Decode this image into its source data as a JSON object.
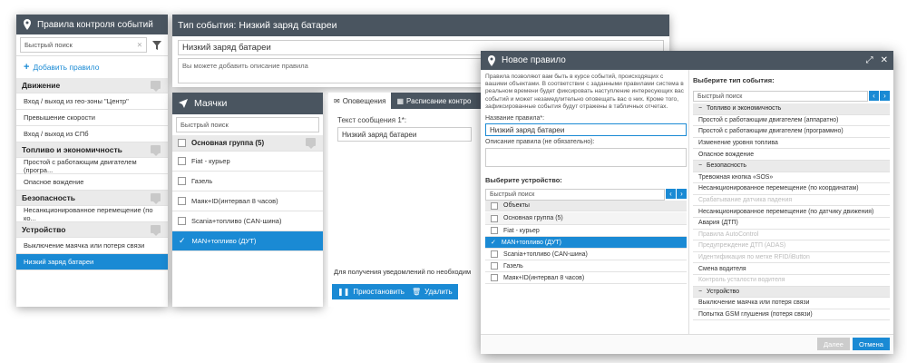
{
  "rules": {
    "title": "Правила контроля событий",
    "search_placeholder": "Быстрый поиск",
    "add_rule": "Добавить правило",
    "groups": [
      {
        "name": "Движение",
        "items": [
          "Вход / выход из гео-зоны \"Центр\"",
          "Превышение скорости",
          "Вход / выход из СПб"
        ]
      },
      {
        "name": "Топливо и экономичность",
        "items": [
          "Простой с работающим двигателем (програ...",
          "Опасное вождение"
        ]
      },
      {
        "name": "Безопасность",
        "items": [
          "Несанкционированное перемещение (по ко..."
        ]
      },
      {
        "name": "Устройство",
        "items": [
          "Выключение маячка или потеря связи",
          "Низкий заряд батареи"
        ]
      }
    ]
  },
  "event": {
    "title": "Тип события: Низкий заряд батареи",
    "name_value": "Низкий заряд батареи",
    "desc_placeholder": "Вы можете добавить описание правила"
  },
  "beacons": {
    "title": "Маячки",
    "search_placeholder": "Быстрый поиск",
    "group": "Основная группа (5)",
    "items": [
      "Fiat - курьер",
      "Газель",
      "Маяк+ID(интервал 8 часов)",
      "Scania+топливо (CAN-шина)",
      "MAN+топливо (ДУТ)"
    ]
  },
  "notif": {
    "tab1": "Оповещения",
    "tab2": "Расписание контро",
    "msg_label": "Текст сообщения 1*:",
    "msg_value": "Низкий заряд батареи",
    "footer_text": "Для получения уведомлений по необходим",
    "pause": "Приостановить",
    "delete": "Удалить"
  },
  "modal": {
    "title": "Новое правило",
    "intro": "Правила позволяют вам быть в курсе событий, происходящих с вашими объектами. В соответствии с заданными правилами система в реальном времени будет фиксировать наступление интересующих вас событий и может незамедлительно оповещать вас о них. Кроме того, зафиксированные события будут отражены в табличных отчетах.",
    "name_label": "Название правила*:",
    "name_value": "Низкий заряд батареи",
    "desc_label": "Описание правила (не обязательно):",
    "device_label": "Выберите устройство:",
    "search_placeholder": "Быстрый поиск",
    "objects_header": "Объекты",
    "device_group": "Основная группа (5)",
    "devices": [
      "Fiat - курьер",
      "MAN+топливо (ДУТ)",
      "Scania+топливо (CAN-шина)",
      "Газель",
      "Маяк+ID(интервал 8 часов)"
    ],
    "event_label": "Выберите тип события:",
    "events": [
      {
        "t": "g",
        "v": "Топливо и экономичность"
      },
      {
        "t": "i",
        "v": "Простой с работающим двигателем (аппаратно)"
      },
      {
        "t": "i",
        "v": "Простой с работающим двигателем (программно)"
      },
      {
        "t": "i",
        "v": "Изменение уровня топлива"
      },
      {
        "t": "i",
        "v": "Опасное вождение"
      },
      {
        "t": "g",
        "v": "Безопасность"
      },
      {
        "t": "i",
        "v": "Тревожная кнопка «SOS»"
      },
      {
        "t": "i",
        "v": "Несанкционированное перемещение (по координатам)"
      },
      {
        "t": "d",
        "v": "Срабатывание датчика падения"
      },
      {
        "t": "i",
        "v": "Несанкционированное перемещение (по датчику движения)"
      },
      {
        "t": "i",
        "v": "Авария (ДТП)"
      },
      {
        "t": "d",
        "v": "Правила AutoControl"
      },
      {
        "t": "d",
        "v": "Предупреждение ДТП (ADAS)"
      },
      {
        "t": "d",
        "v": "Идентификация по метке RFID/iButton"
      },
      {
        "t": "i",
        "v": "Смена водителя"
      },
      {
        "t": "d",
        "v": "Контроль усталости водителя"
      },
      {
        "t": "g",
        "v": "Устройство"
      },
      {
        "t": "i",
        "v": "Выключение маячка или потеря связи"
      },
      {
        "t": "i",
        "v": "Попытка GSM глушения (потеря связи)"
      }
    ],
    "done": "Далее",
    "cancel": "Отмена"
  }
}
